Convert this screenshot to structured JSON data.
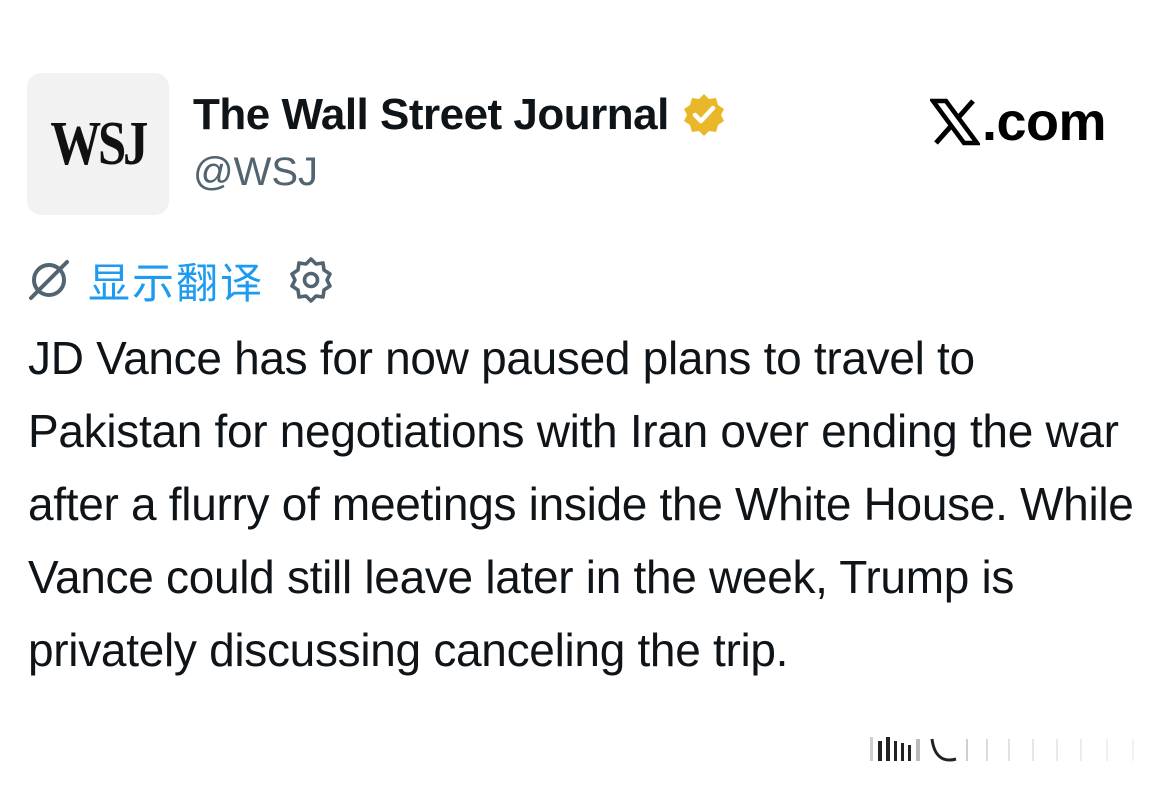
{
  "account": {
    "avatar_text": "WSJ",
    "display_name": "The Wall Street Journal",
    "handle": "@WSJ",
    "verified": true,
    "verified_color": "#e8b829"
  },
  "brand": {
    "domain": ".com",
    "icon": "x-logo-icon"
  },
  "translate": {
    "label": "显示翻译",
    "icon": "translate-icon",
    "settings_icon": "gear-icon",
    "color": "#1d9bf0"
  },
  "tweet": {
    "text": "JD Vance has for now paused plans to travel to Pakistan for negotiations with Iran over ending the war after a flurry of meetings inside the White House. While Vance could still leave later in the week, Trump is privately discussing canceling the trip."
  }
}
